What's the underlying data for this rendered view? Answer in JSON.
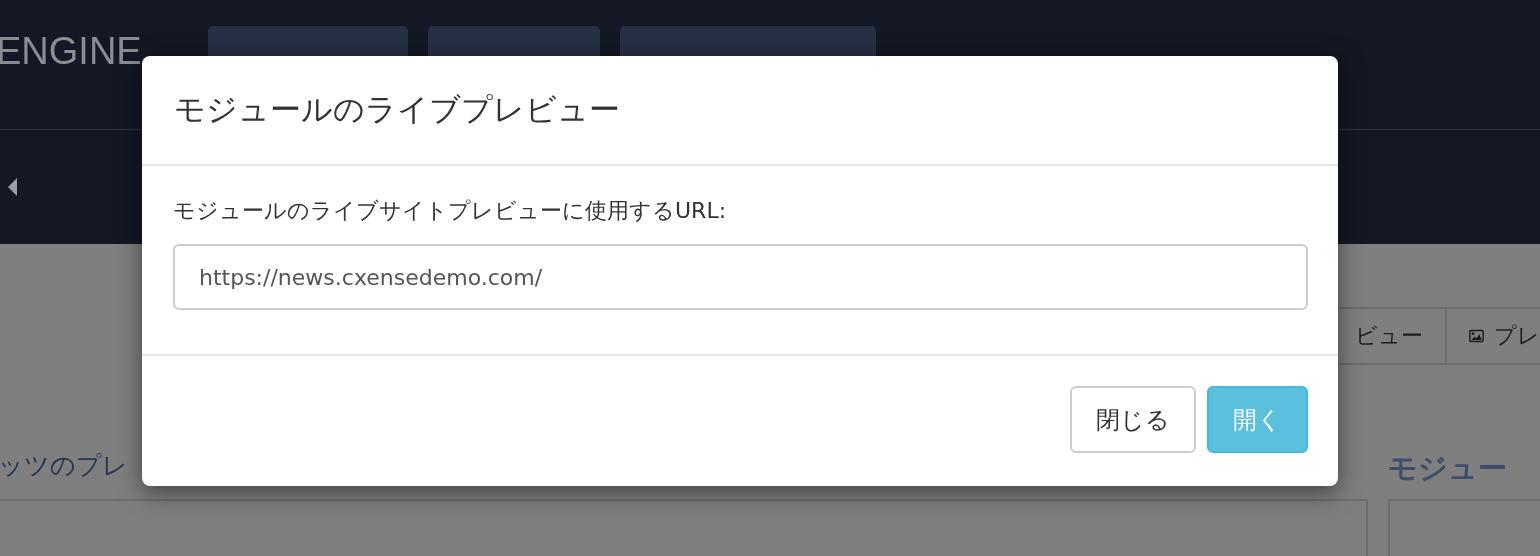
{
  "header": {
    "logo": "ENGINE"
  },
  "page": {
    "toolbar": [
      {
        "label": "ビュー",
        "kind": "text"
      },
      {
        "label": "プレ",
        "kind": "image"
      }
    ],
    "left_heading": "ッツのプレ",
    "right_heading": "モジュー"
  },
  "dialog": {
    "title": "モジュールのライブプレビュー",
    "field_label": "モジュールのライブサイトプレビューに使用するURL:",
    "url": {
      "value": "https://news.cxensedemo.com/"
    },
    "buttons": [
      {
        "label": "閉じる",
        "kind": "default"
      },
      {
        "label": "開く",
        "kind": "primary"
      }
    ]
  }
}
